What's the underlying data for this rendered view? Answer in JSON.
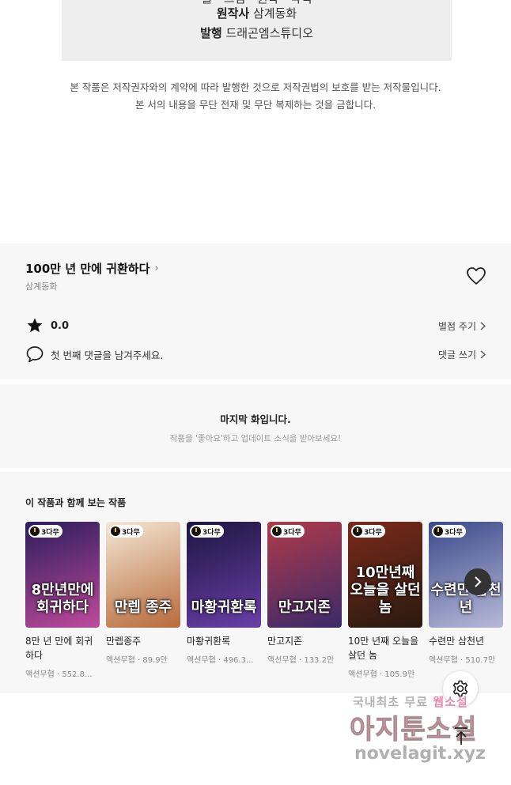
{
  "credits": {
    "cut_line": "글 · 그림 · 원작 · 각색",
    "original_label": "원작사",
    "original_value": "삼계동화",
    "publisher_label": "발행",
    "publisher_value": "드래곤엠스튜디오"
  },
  "copyright": {
    "line1": "본 작품은 저작권자와의 계약에 따라 발행한 것으로 저작권법의 보호를 받는 저작물입니다.",
    "line2": "본 서의 내용을 무단 전재 및 무단 복제하는 것을 금합니다."
  },
  "series": {
    "title": "100만 년 만에 귀환하다",
    "title_chevron": "›",
    "author": "삼계동화",
    "rating": "0.0",
    "rate_link": "별점 주기",
    "comment_prompt": "첫 번째 댓글을 남겨주세요.",
    "comment_link": "댓글 쓰기"
  },
  "last_episode": {
    "title": "마지막 화입니다.",
    "subtitle": "작품을 '좋아요'하고 업데이트 소식을 받아보세요!"
  },
  "recommendations": {
    "heading": "이 작품과 함께 보는 작품",
    "badge_label": "3다무",
    "items": [
      {
        "title": "8만 년 만에 회귀하다",
        "art": "8만년만에 회귀하다",
        "meta": "액션무협 · 552.8..."
      },
      {
        "title": "만렙종주",
        "art": "만렙 종주",
        "meta": "액션무협 · 89.9만"
      },
      {
        "title": "마황귀환록",
        "art": "마황귀환록",
        "meta": "액션무협 · 496.3..."
      },
      {
        "title": "만고지존",
        "art": "만고지존",
        "meta": "액션무협 · 133.2만"
      },
      {
        "title": "10만 년째 오늘을 살던 놈",
        "art": "10만년째 오늘을 살던 놈",
        "meta": "액션무협 · 105.9만"
      },
      {
        "title": "수련만 삼천년",
        "art": "수련만 삼천년",
        "meta": "액션무협 · 510.7만"
      }
    ]
  },
  "watermark": {
    "line1_a": "국내최초 무료",
    "line1_b": "웹소설",
    "line2": "아지툰소설",
    "line3": "novelagit.xyz"
  },
  "colors": {
    "panel_bg": "#f7f7f7",
    "badge_accent": "#f2c200",
    "thumb_gradients": [
      [
        "#2b1d5c",
        "#c04a9b"
      ],
      [
        "#f3e7d5",
        "#b86a3a"
      ],
      [
        "#1c1640",
        "#6a3fa8"
      ],
      [
        "#b03a4a",
        "#3a2a6a"
      ],
      [
        "#7a2a1a",
        "#2a1a10"
      ],
      [
        "#3a4a8a",
        "#b7b9d8"
      ]
    ]
  },
  "icons": {
    "heart": "heart-outline-icon",
    "star": "star-filled-icon",
    "comment": "speech-bubble-icon",
    "next": "chevron-right-icon",
    "settings": "gear-icon",
    "scroll_top": "arrow-up-to-top-icon"
  }
}
